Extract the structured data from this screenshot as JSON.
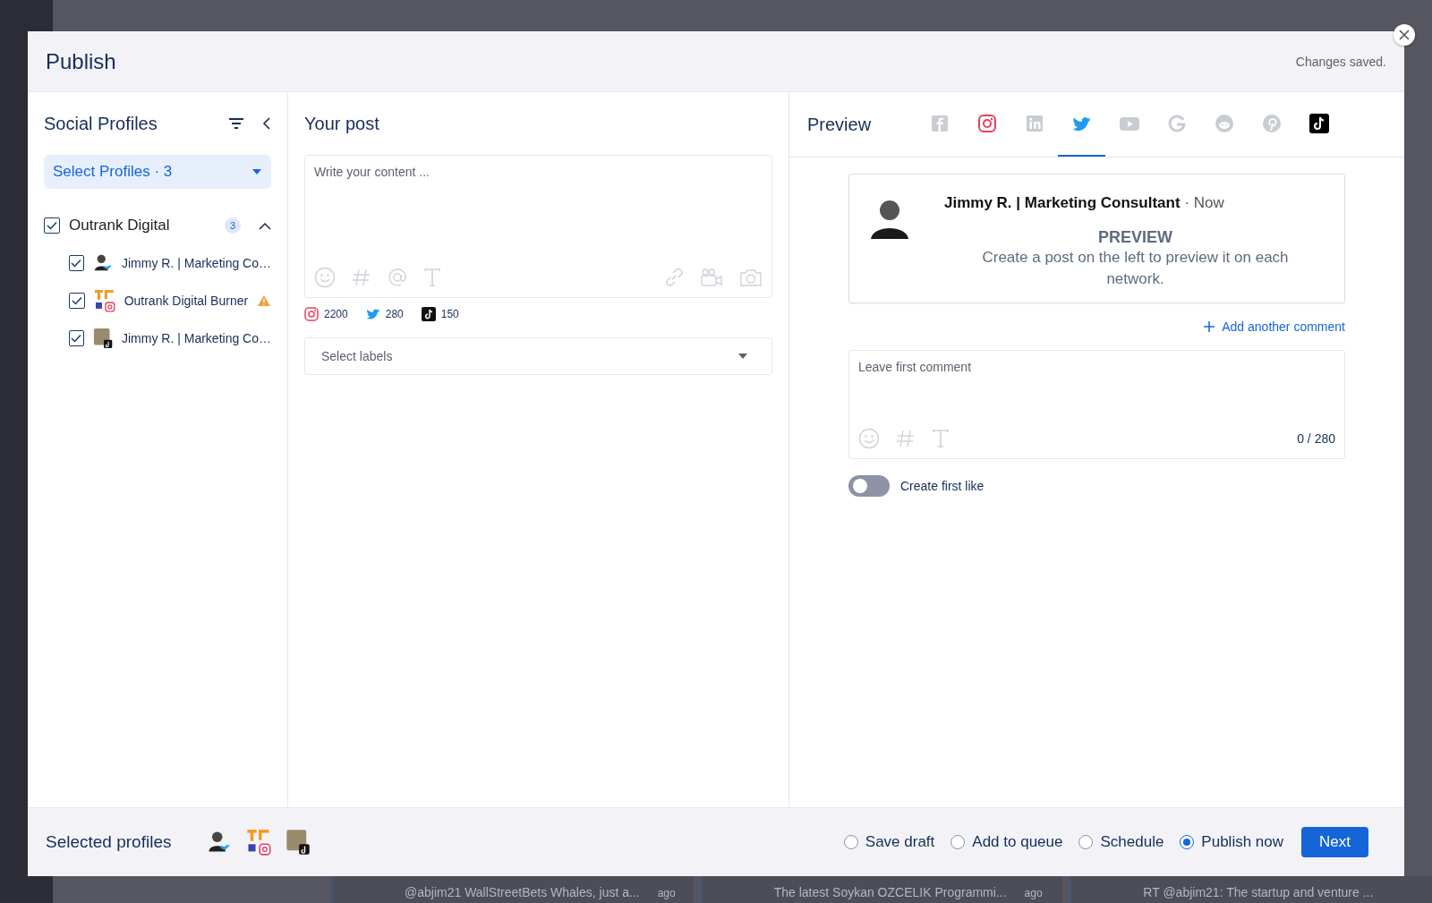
{
  "modal": {
    "title": "Publish",
    "status": "Changes saved."
  },
  "profiles_panel": {
    "title": "Social Profiles",
    "select": {
      "label": "Select Profiles · 3"
    },
    "groups": [
      {
        "name": "Outrank Digital",
        "count": "3",
        "checked": true,
        "expanded": true,
        "children": [
          {
            "name": "Jimmy R. | Marketing Co…",
            "checked": true,
            "avatar": {
              "kind": "person"
            },
            "network": {
              "kind": "twitter"
            },
            "warning": false
          },
          {
            "name": "Outrank Digital Burner",
            "checked": true,
            "avatar": {
              "kind": "logo"
            },
            "network": {
              "kind": "instagram"
            },
            "warning": true
          },
          {
            "name": "Jimmy R. | Marketing Co…",
            "checked": true,
            "avatar": {
              "kind": "photo"
            },
            "network": {
              "kind": "tiktok"
            },
            "warning": false
          }
        ]
      }
    ]
  },
  "post": {
    "title": "Your post",
    "placeholder": "Write your content ...",
    "limits": [
      {
        "network": {
          "kind": "instagram"
        },
        "count": "2200"
      },
      {
        "network": {
          "kind": "twitter"
        },
        "count": "280"
      },
      {
        "network": {
          "kind": "tiktok"
        },
        "count": "150"
      }
    ],
    "labels_placeholder": "Select labels"
  },
  "preview": {
    "title": "Preview",
    "networks": [
      {
        "kind": "facebook",
        "selected": false,
        "enabled": false
      },
      {
        "kind": "instagram",
        "selected": false,
        "enabled": true
      },
      {
        "kind": "linkedin",
        "selected": false,
        "enabled": false
      },
      {
        "kind": "twitter",
        "selected": true,
        "enabled": true
      },
      {
        "kind": "youtube",
        "selected": false,
        "enabled": false
      },
      {
        "kind": "google",
        "selected": false,
        "enabled": false
      },
      {
        "kind": "reddit",
        "selected": false,
        "enabled": false
      },
      {
        "kind": "pinterest",
        "selected": false,
        "enabled": false
      },
      {
        "kind": "tiktok",
        "selected": false,
        "enabled": true
      }
    ],
    "card": {
      "author": "Jimmy R. | Marketing Consultant",
      "time": "· Now",
      "heading": "PREVIEW",
      "message": "Create a post on the left to preview it on each network."
    },
    "add_comment": "Add another comment",
    "comment": {
      "placeholder": "Leave first comment",
      "counter": "0 / 280"
    },
    "first_like": {
      "label": "Create first like",
      "on": false
    }
  },
  "footer": {
    "title": "Selected profiles",
    "profiles": [
      {
        "avatar": {
          "kind": "person"
        },
        "network": {
          "kind": "twitter"
        }
      },
      {
        "avatar": {
          "kind": "logo"
        },
        "network": {
          "kind": "instagram"
        }
      },
      {
        "avatar": {
          "kind": "photo"
        },
        "network": {
          "kind": "tiktok"
        }
      }
    ],
    "options": [
      {
        "label": "Save draft",
        "selected": false
      },
      {
        "label": "Add to queue",
        "selected": false
      },
      {
        "label": "Schedule",
        "selected": false
      },
      {
        "label": "Publish now",
        "selected": true
      }
    ],
    "next": "Next"
  },
  "background": {
    "posts": [
      {
        "text": "@abjim21 WallStreetBets Whales, just a...",
        "time": "ago"
      },
      {
        "text": "The latest Soykan OZCELIK Programmi...",
        "time": "ago"
      },
      {
        "text": "RT @abjim21: The startup and venture ..."
      }
    ]
  }
}
